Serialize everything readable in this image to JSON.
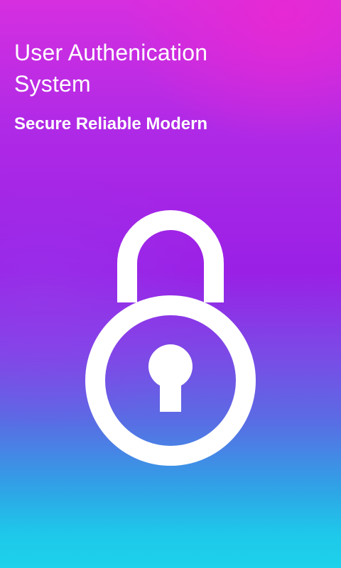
{
  "app": {
    "title_line1": "User Authenication",
    "title_line2": "System",
    "tagline": "Secure Reliable Modern"
  },
  "icon": {
    "name": "lock-icon",
    "color": "#ffffff"
  },
  "colors": {
    "gradient_top": "#d62fe0",
    "gradient_middle": "#9a20e6",
    "gradient_bottom": "#1dd2ea"
  }
}
